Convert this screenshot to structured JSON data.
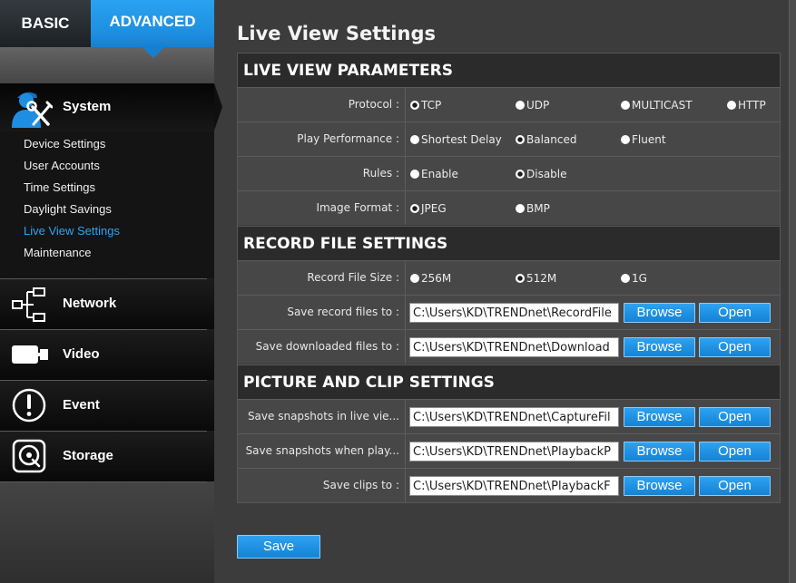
{
  "colors": {
    "accent": "#1e8fe0",
    "active_item": "#2ea3f2"
  },
  "tabs": {
    "basic": "BASIC",
    "advanced": "ADVANCED"
  },
  "sidebar": {
    "system": {
      "label": "System",
      "icon": "system-maintenance-icon",
      "items": [
        "Device Settings",
        "User Accounts",
        "Time Settings",
        "Daylight Savings",
        "Live View Settings",
        "Maintenance"
      ],
      "active_index": 4
    },
    "network": {
      "label": "Network",
      "icon": "network-icon"
    },
    "video": {
      "label": "Video",
      "icon": "video-camera-icon"
    },
    "event": {
      "label": "Event",
      "icon": "alert-icon"
    },
    "storage": {
      "label": "Storage",
      "icon": "storage-disk-icon"
    }
  },
  "page_title": "Live View Settings",
  "live_view_parameters": {
    "header": "LIVE VIEW PARAMETERS",
    "protocol": {
      "label": "Protocol :",
      "options": [
        "TCP",
        "UDP",
        "MULTICAST",
        "HTTP"
      ],
      "selected_index": 0
    },
    "play_performance": {
      "label": "Play Performance :",
      "options": [
        "Shortest Delay",
        "Balanced",
        "Fluent"
      ],
      "selected_index": 1
    },
    "rules": {
      "label": "Rules :",
      "options": [
        "Enable",
        "Disable"
      ],
      "selected_index": 1
    },
    "image_format": {
      "label": "Image Format :",
      "options": [
        "JPEG",
        "BMP"
      ],
      "selected_index": 0
    }
  },
  "record_file_settings": {
    "header": "RECORD FILE SETTINGS",
    "record_file_size": {
      "label": "Record File Size :",
      "options": [
        "256M",
        "512M",
        "1G"
      ],
      "selected_index": 1
    },
    "save_record_files": {
      "label": "Save record files to :",
      "value": "C:\\Users\\KD\\TRENDnet\\RecordFile"
    },
    "save_downloaded_files": {
      "label": "Save downloaded files to :",
      "value": "C:\\Users\\KD\\TRENDnet\\Download"
    }
  },
  "picture_and_clip_settings": {
    "header": "PICTURE AND CLIP SETTINGS",
    "save_snapshots_live": {
      "label": "Save snapshots in live vie...",
      "value": "C:\\Users\\KD\\TRENDnet\\CaptureFil"
    },
    "save_snapshots_playback": {
      "label": "Save snapshots when play...",
      "value": "C:\\Users\\KD\\TRENDnet\\PlaybackP"
    },
    "save_clips": {
      "label": "Save clips to :",
      "value": "C:\\Users\\KD\\TRENDnet\\PlaybackF"
    }
  },
  "buttons": {
    "browse": "Browse",
    "open": "Open",
    "save": "Save"
  }
}
